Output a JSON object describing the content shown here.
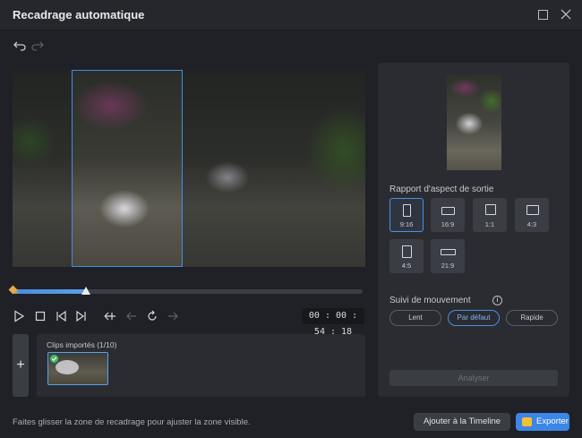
{
  "window": {
    "title": "Recadrage automatique"
  },
  "preview": {
    "timecode": "00 : 00 : 54 : 18",
    "progress": 0.21
  },
  "clips": {
    "title": "Clips importés (1/10)",
    "add_label": "+"
  },
  "side": {
    "aspect_label": "Rapport d'aspect de sortie",
    "ratios": [
      {
        "label": "9:16",
        "active": true
      },
      {
        "label": "16:9",
        "active": false
      },
      {
        "label": "1:1",
        "active": false
      },
      {
        "label": "4:3",
        "active": false
      },
      {
        "label": "4:5",
        "active": false
      },
      {
        "label": "21:9",
        "active": false
      }
    ],
    "motion_label": "Suivi de mouvement",
    "info_glyph": "i",
    "motion_options": [
      {
        "label": "Lent",
        "active": false
      },
      {
        "label": "Par défaut",
        "active": true
      },
      {
        "label": "Rapide",
        "active": false
      }
    ],
    "analyze_label": "Analyser"
  },
  "footer": {
    "hint": "Faites glisser la zone de recadrage pour ajuster la zone visible.",
    "add_timeline": "Ajouter à la Timeline",
    "export": "Exporter"
  },
  "colors": {
    "accent": "#3c86e6",
    "crop_border": "#3f8ee8",
    "check": "#3fbf62",
    "export_icon": "#f2c233"
  }
}
